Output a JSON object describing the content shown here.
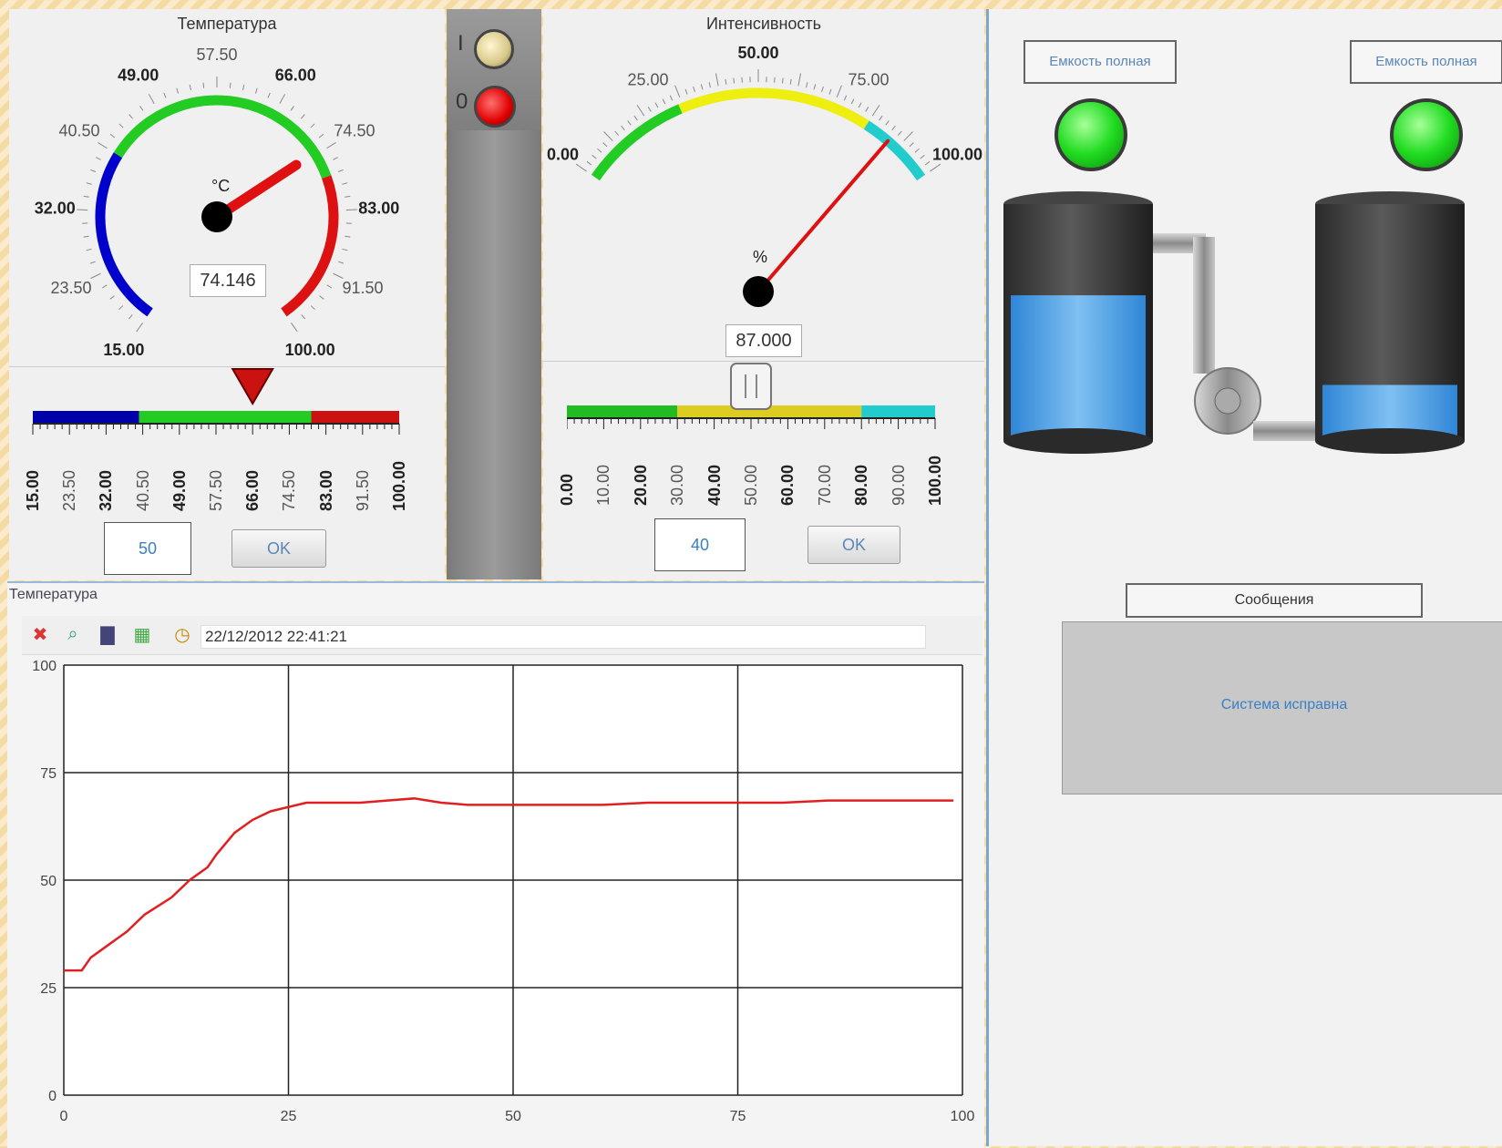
{
  "temp_gauge": {
    "title": "Температура",
    "unit": "°C",
    "value": "74.146",
    "needle_value": 74.146,
    "min": 15,
    "max": 100,
    "ticks": [
      "15.00",
      "23.50",
      "32.00",
      "40.50",
      "49.00",
      "57.50",
      "66.00",
      "74.50",
      "83.00",
      "91.50",
      "100.00"
    ],
    "colors": {
      "low": "#0000cc",
      "mid": "#22cc22",
      "high": "#dd1111"
    }
  },
  "temp_slider": {
    "ticks": [
      "15.00",
      "23.50",
      "32.00",
      "40.50",
      "49.00",
      "57.50",
      "66.00",
      "74.50",
      "83.00",
      "91.50",
      "100.00"
    ],
    "marker_value": 66,
    "input_value": "50",
    "ok_label": "OK"
  },
  "switch": {
    "top_label": "I",
    "bottom_label": "0"
  },
  "intensity_gauge": {
    "title": "Интенсивность",
    "unit": "%",
    "value": "87.000",
    "needle_value": 87,
    "min": 0,
    "max": 100,
    "ticks": [
      "0.00",
      "25.00",
      "50.00",
      "75.00",
      "100.00"
    ],
    "colors": {
      "low": "#22cc22",
      "mid": "#eeee11",
      "high": "#22cccc"
    }
  },
  "intensity_slider": {
    "ticks": [
      "0.00",
      "10.00",
      "20.00",
      "30.00",
      "40.00",
      "50.00",
      "60.00",
      "70.00",
      "80.00",
      "90.00",
      "100.00"
    ],
    "thumb_value": 50,
    "input_value": "40",
    "ok_label": "OK"
  },
  "trend": {
    "panel_title": "Температура",
    "timestamp": "22/12/2012 22:41:21",
    "toolbar_icons": [
      "zoom-reset-icon",
      "zoom-icon",
      "save-icon",
      "export-icon",
      "clock-icon"
    ]
  },
  "chart_data": {
    "type": "line",
    "title": "Температура",
    "xlim": [
      0,
      100
    ],
    "ylim": [
      0,
      100
    ],
    "x_ticks": [
      "0",
      "25",
      "50",
      "75",
      "100"
    ],
    "y_ticks": [
      "0",
      "25",
      "50",
      "75",
      "100"
    ],
    "grid": true,
    "series": [
      {
        "color": "#e02020",
        "x": [
          0,
          2,
          3,
          5,
          7,
          9,
          12,
          14,
          16,
          17,
          19,
          21,
          23,
          25,
          27,
          30,
          33,
          36,
          39,
          42,
          45,
          48,
          50,
          55,
          60,
          65,
          70,
          75,
          80,
          85,
          90,
          95,
          99
        ],
        "y": [
          29,
          29,
          32,
          35,
          38,
          42,
          46,
          50,
          53,
          56,
          61,
          64,
          66,
          67,
          68,
          68,
          68,
          68.5,
          69,
          68,
          67.5,
          67.5,
          67.5,
          67.5,
          67.5,
          68,
          68,
          68,
          68,
          68.5,
          68.5,
          68.5,
          68.5
        ]
      }
    ]
  },
  "tanks": {
    "left_label": "Емкость полная",
    "right_label": "Емкость полная",
    "left_level": 0.65,
    "right_level": 0.25,
    "indicator_color": "#22dd22"
  },
  "messages": {
    "header": "Сообщения",
    "text": "Система исправна"
  }
}
